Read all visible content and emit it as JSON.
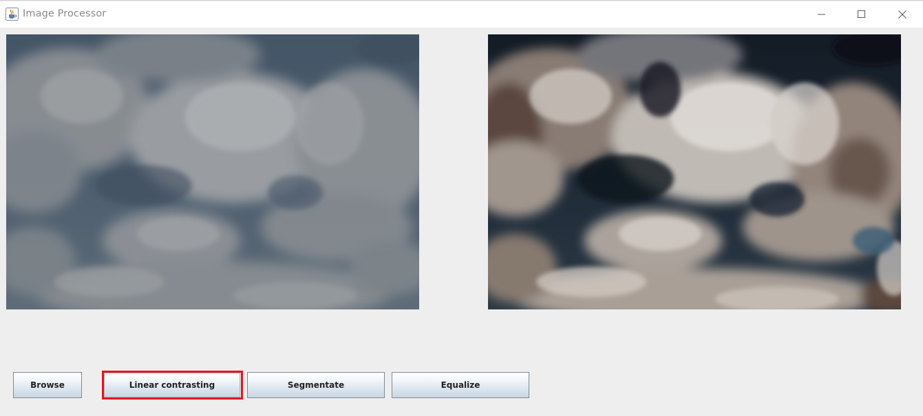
{
  "window": {
    "title": "Image Processor",
    "icon": "java-cup-icon",
    "controls": [
      "minimize-icon",
      "maximize-icon",
      "close-icon"
    ]
  },
  "images": {
    "original": {
      "description_name": "original-clouds-image"
    },
    "processed": {
      "description_name": "processed-clouds-image"
    }
  },
  "buttons": {
    "browse": "Browse",
    "linear_contrasting": "Linear contrasting",
    "segmentate": "Segmentate",
    "equalize": "Equalize"
  },
  "highlight": {
    "target": "linear_contrasting",
    "color": "#e8141b"
  },
  "colors": {
    "window_bg": "#eeeeee",
    "titlebar_bg": "#ffffff",
    "title_text": "#8a8a8a"
  }
}
